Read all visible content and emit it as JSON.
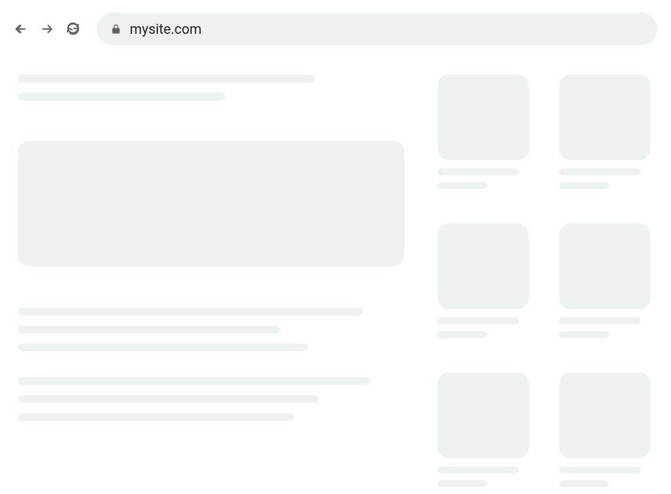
{
  "browser": {
    "url": "mysite.com"
  }
}
